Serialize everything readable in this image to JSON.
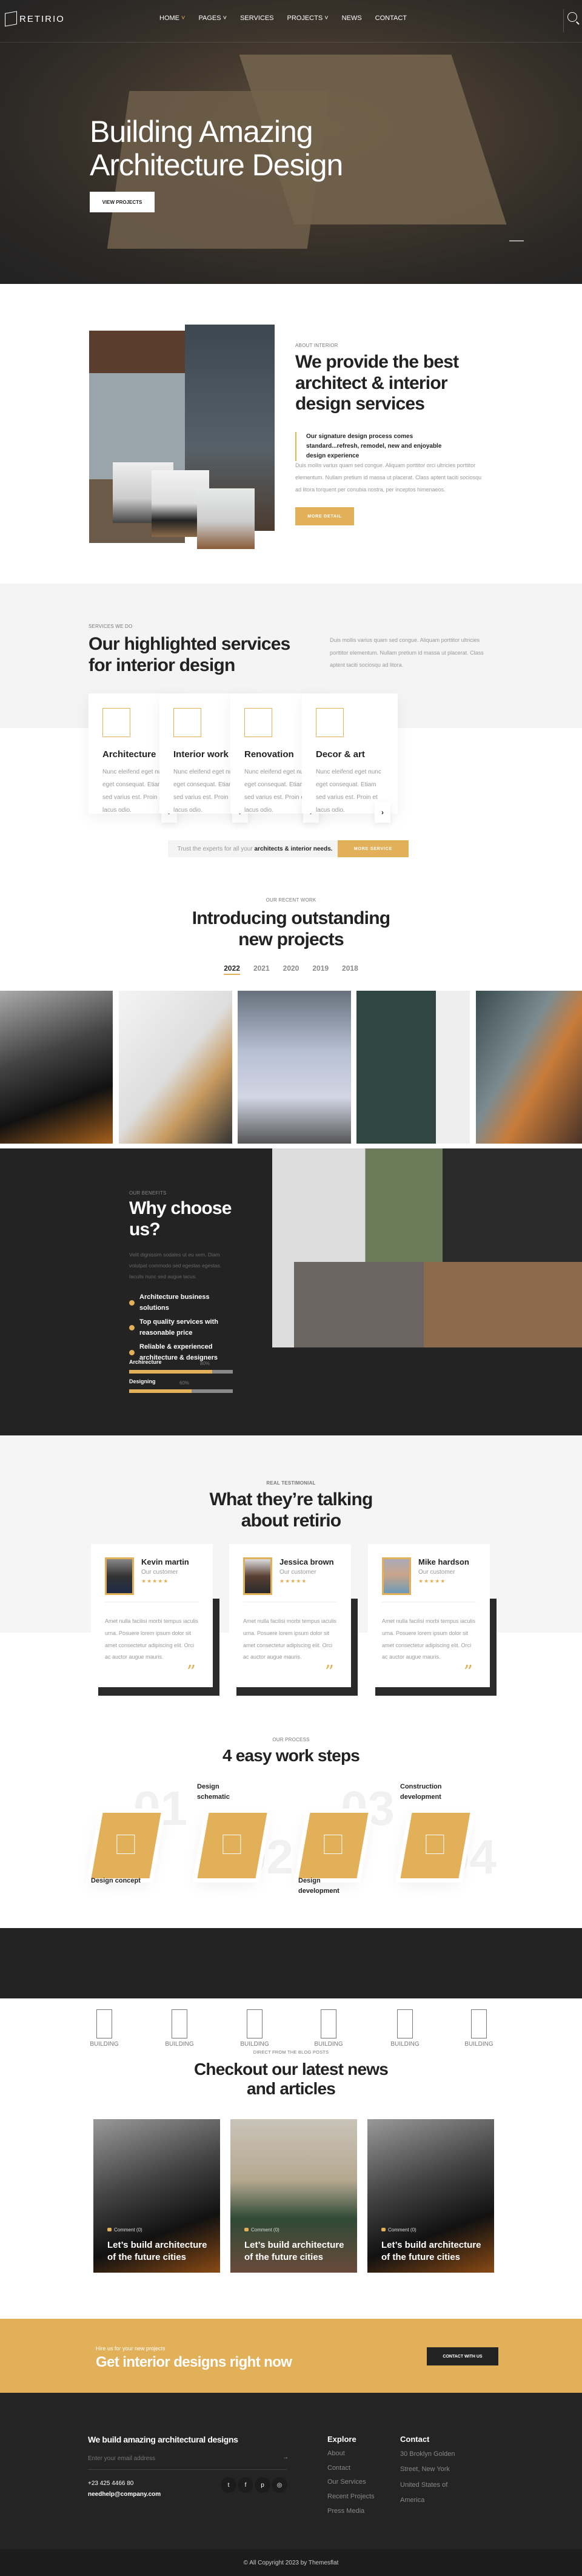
{
  "colors": {
    "accent": "#e2b058",
    "dark": "#232323",
    "light_bg": "#f5f5f5"
  },
  "nav": {
    "brand": "RETIRIO",
    "items": [
      {
        "label": "HOME",
        "active": true,
        "dropdown": true
      },
      {
        "label": "PAGES",
        "dropdown": true
      },
      {
        "label": "SERVICES"
      },
      {
        "label": "PROJECTS",
        "dropdown": true
      },
      {
        "label": "NEWS"
      },
      {
        "label": "CONTACT"
      }
    ],
    "search_icon": "search-icon"
  },
  "hero": {
    "title_line1": "Building Amazing",
    "title_line2": "Architecture Design",
    "button": "VIEW PROJECTS"
  },
  "about": {
    "label": "ABOUT INTERIOR",
    "title": "We provide the best architect & interior design services",
    "quote": "Our signature design process comes standard...refresh, remodel, new and enjoyable design experience",
    "body": "Duis mollis varius quam sed congue. Aliquam porttitor orci ultricies porttitor elementum. Nullam pretium id massa ut placerat. Class aptent taciti sociosqu ad litora torquent per conubia nostra, per inceptos himenaeos.",
    "button": "MORE DETAIL"
  },
  "services": {
    "label": "SERVICES WE DO",
    "title": "Our highlighted services for interior design",
    "intro": "Duis mollis varius quam sed congue. Aliquam porttitor ultricies porttitor elementum. Nullam pretium id massa ut placerat. Class aptent taciti sociosqu ad litora.",
    "cards": [
      {
        "title": "Architecture",
        "text": "Nunc eleifend eget nunc eget consequat. Etiam sed varius est. Proin et lacus odio.",
        "icon": "buildings-icon"
      },
      {
        "title": "Interior work",
        "text": "Nunc eleifend eget nunc eget consequat. Etiam sed varius est. Proin et lacus odio.",
        "icon": "armchair-icon"
      },
      {
        "title": "Renovation",
        "text": "Nunc eleifend eget nunc eget consequat. Etiam sed varius est. Proin et lacus odio.",
        "icon": "blueprint-house-icon"
      },
      {
        "title": "Decor & art",
        "text": "Nunc eleifend eget nunc eget consequat. Etiam sed varius est. Proin et lacus odio.",
        "icon": "kitchen-icon"
      }
    ],
    "trust_text": "Trust the experts for all your ",
    "trust_bold": "architects & interior needs.",
    "button": "MORE SERVICE"
  },
  "projects": {
    "label": "OUR RECENT WORK",
    "title_line1": "Introducing outstanding",
    "title_line2": "new projects",
    "years": [
      "2022",
      "2021",
      "2020",
      "2019",
      "2018"
    ],
    "active_year": "2022"
  },
  "why": {
    "label": "OUR BENEFITS",
    "title_line1": "Why choose",
    "title_line2": "us?",
    "body": "Velit dignissim sodales ut eu sem. Diam volutpat commodo sed egestas egestas. Iaculis nunc sed augue lacus.",
    "points": [
      "Architecture business solutions",
      "Top quality services with reasonable price",
      "Reliable & experienced architecture & designers"
    ],
    "skills": [
      {
        "name": "Archirecture",
        "value": 80,
        "label": "80%"
      },
      {
        "name": "Designing",
        "value": 60,
        "label": "60%"
      }
    ]
  },
  "testimonials": {
    "label": "REAL TESTIMONIAL",
    "title_line1": "What they’re talking",
    "title_line2": "about retirio",
    "items": [
      {
        "name": "Kevin martin",
        "role": "Our customer",
        "rating": 5,
        "text": "Amet nulla facilisi morbi tempus iaculis urna. Posuere lorem ipsum dolor sit amet consectetur adipiscing elit. Orci ac auctor augue mauris."
      },
      {
        "name": "Jessica brown",
        "role": "Our customer",
        "rating": 5,
        "text": "Amet nulla facilisi morbi tempus iaculis urna. Posuere lorem ipsum dolor sit amet consectetur adipiscing elit. Orci ac auctor augue mauris."
      },
      {
        "name": "Mike hardson",
        "role": "Our customer",
        "rating": 5,
        "text": "Amet nulla facilisi morbi tempus iaculis urna. Posuere lorem ipsum dolor sit amet consectetur adipiscing elit. Orci ac auctor augue mauris."
      }
    ]
  },
  "process": {
    "label": "OUR PROCESS",
    "title": "4 easy work steps",
    "steps": [
      {
        "num": "01",
        "title": "Design concept"
      },
      {
        "num": "02",
        "title": "Design schematic"
      },
      {
        "num": "03",
        "title": "Design development"
      },
      {
        "num": "04",
        "title": "Construction development"
      }
    ]
  },
  "partners": {
    "logos": [
      "BUILDING",
      "BUILDING",
      "BUILDING",
      "BUILDING",
      "BUILDING",
      "BUILDING"
    ]
  },
  "blog": {
    "label": "DIRECT FROM THE BLOG POSTS",
    "title_line1": "Checkout our latest news",
    "title_line2": "and articles",
    "posts": [
      {
        "meta": "Comment (0)",
        "title": "Let’s build architecture of the future cities"
      },
      {
        "meta": "Comment (0)",
        "title": "Let’s build architecture of the future cities"
      },
      {
        "meta": "Comment (0)",
        "title": "Let’s build architecture of the future cities"
      }
    ]
  },
  "cta": {
    "small": "Hire us for your new projects",
    "title": "Get interior designs right now",
    "button": "CONTACT WITH US"
  },
  "footer": {
    "tagline": "We build amazing architectural designs",
    "email_placeholder": "Enter your email address",
    "phone": "+23 425 4466 80",
    "email": "needhelp@company.com",
    "explore_title": "Explore",
    "explore": [
      "About",
      "Contact",
      "Our Services",
      "Recent Projects",
      "Press Media"
    ],
    "contact_title": "Contact",
    "address": "30 Broklyn Golden Street, New York United States of America",
    "copyright": "© All Copyright 2023 by Themesflat",
    "socials": [
      "twitter-icon",
      "facebook-icon",
      "pinterest-icon",
      "instagram-icon"
    ]
  }
}
